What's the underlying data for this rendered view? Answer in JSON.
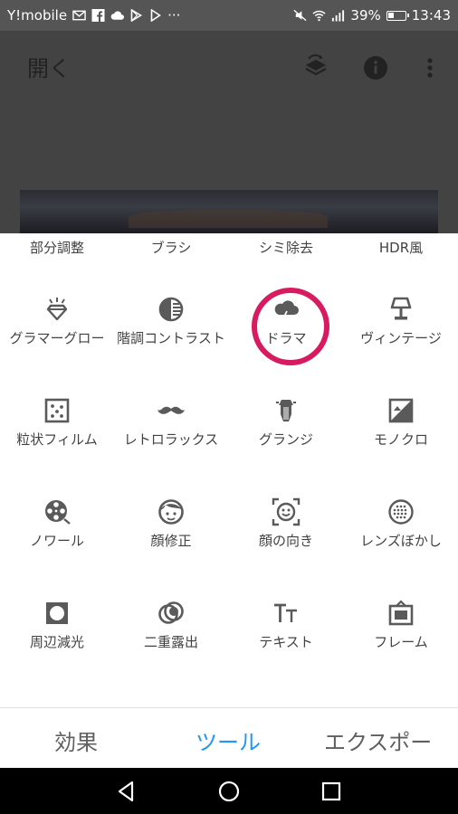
{
  "status_bar": {
    "carrier": "Y!mobile",
    "more": "···",
    "battery": "39%",
    "time": "13:43"
  },
  "app_bar": {
    "title": "開く"
  },
  "tools_top_row": [
    "部分調整",
    "ブラシ",
    "シミ除去",
    "HDR風"
  ],
  "tools": [
    {
      "label": "グラマーグロー",
      "icon": "diamond-icon"
    },
    {
      "label": "階調コントラスト",
      "icon": "tonal-contrast-icon"
    },
    {
      "label": "ドラマ",
      "icon": "storm-cloud-icon"
    },
    {
      "label": "ヴィンテージ",
      "icon": "lamp-icon"
    },
    {
      "label": "粒状フィルム",
      "icon": "grain-icon"
    },
    {
      "label": "レトロラックス",
      "icon": "mustache-icon"
    },
    {
      "label": "グランジ",
      "icon": "guitar-icon"
    },
    {
      "label": "モノクロ",
      "icon": "mono-icon"
    },
    {
      "label": "ノワール",
      "icon": "film-reel-icon"
    },
    {
      "label": "顔修正",
      "icon": "face-icon"
    },
    {
      "label": "顔の向き",
      "icon": "face-pose-icon"
    },
    {
      "label": "レンズぼかし",
      "icon": "lens-blur-icon"
    },
    {
      "label": "周辺減光",
      "icon": "vignette-icon"
    },
    {
      "label": "二重露出",
      "icon": "double-exposure-icon"
    },
    {
      "label": "テキスト",
      "icon": "text-icon"
    },
    {
      "label": "フレーム",
      "icon": "frame-icon"
    }
  ],
  "bottom_tabs": [
    {
      "label": "効果",
      "active": false
    },
    {
      "label": "ツール",
      "active": true
    },
    {
      "label": "エクスポー",
      "active": false
    }
  ],
  "colors": {
    "accent": "#2196f3",
    "highlight_circle": "#d81b60",
    "icon": "#5a5a5a"
  }
}
